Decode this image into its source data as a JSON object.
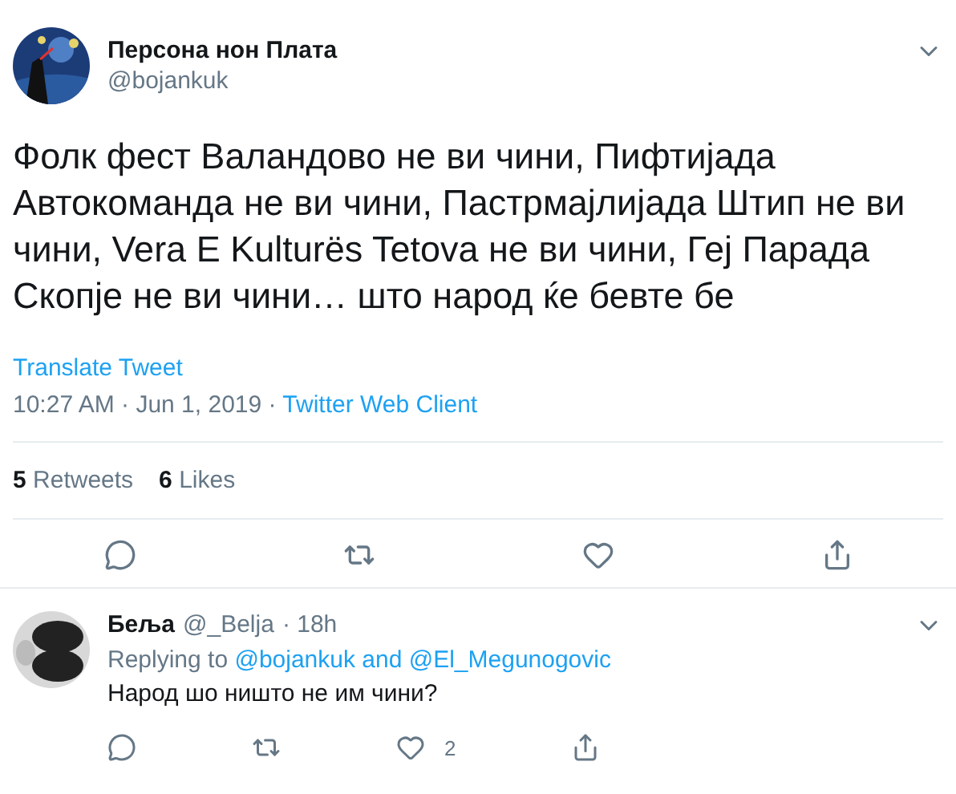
{
  "tweet": {
    "name": "Персона нон Плата",
    "handle": "@bojankuk",
    "text": "Фолк фест Валандово не ви чини, Пифтијада Автокоманда не ви чини, Пастрмајлијада Штип не ви чини, Vera E Kulturës Tetova не ви чини, Геј Парада Скопје не ви чини… што народ ќе бевте бе",
    "translate": "Translate Tweet",
    "time": "10:27 AM · Jun 1, 2019 · ",
    "client": "Twitter Web Client",
    "stats": [
      {
        "count": "5",
        "label": "Retweets"
      },
      {
        "count": "6",
        "label": "Likes"
      }
    ]
  },
  "reply": {
    "name": "Беља",
    "handle": "@_Belja",
    "age": "· 18h",
    "replying_to": "Replying to ",
    "mentions": "@bojankuk and @El_Megunogovic",
    "text": "Народ шо ништо не им чини?",
    "like_count": "2"
  }
}
